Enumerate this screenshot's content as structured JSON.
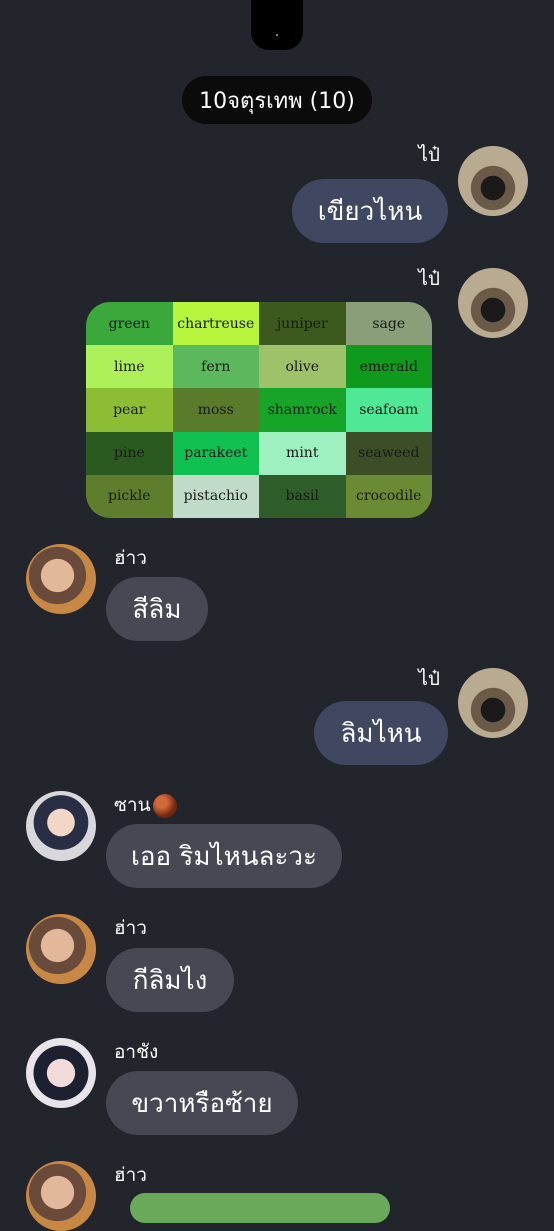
{
  "top_indicator": ".",
  "group_title": "10จตุรเทพ (10)",
  "messages": [
    {
      "sender": "ไป๋",
      "text": "เขียวไหน"
    },
    {
      "sender": "ไป๋"
    },
    {
      "sender": "ฮ่าว",
      "text": "สีลิม"
    },
    {
      "sender": "ไป๋",
      "text": "ลิมไหน"
    },
    {
      "sender": "ซาน",
      "text": "เออ ริมไหนละวะ"
    },
    {
      "sender": "ฮ่าว",
      "text": "กีลิมไง"
    },
    {
      "sender": "อาชัง",
      "text": "ขวาหรือซ้าย"
    },
    {
      "sender": "ฮ่าว"
    }
  ],
  "color_chart": [
    {
      "label": "green",
      "color": "#3aa83a"
    },
    {
      "label": "chartreuse",
      "color": "#b7f53c"
    },
    {
      "label": "juniper",
      "color": "#3c5a1e"
    },
    {
      "label": "sage",
      "color": "#8a9e7a"
    },
    {
      "label": "lime",
      "color": "#aef05a"
    },
    {
      "label": "fern",
      "color": "#5cb85c"
    },
    {
      "label": "olive",
      "color": "#9ec26a"
    },
    {
      "label": "emerald",
      "color": "#0f9a1e"
    },
    {
      "label": "pear",
      "color": "#8cbd34"
    },
    {
      "label": "moss",
      "color": "#5a7c2a"
    },
    {
      "label": "shamrock",
      "color": "#16a528"
    },
    {
      "label": "seafoam",
      "color": "#4ee896"
    },
    {
      "label": "pine",
      "color": "#2b5a20"
    },
    {
      "label": "parakeet",
      "color": "#10c050"
    },
    {
      "label": "mint",
      "color": "#9ef0c0"
    },
    {
      "label": "seaweed",
      "color": "#3c4e26"
    },
    {
      "label": "pickle",
      "color": "#5e7e2e"
    },
    {
      "label": "pistachio",
      "color": "#c0dcc8"
    },
    {
      "label": "basil",
      "color": "#305e2a"
    },
    {
      "label": "crocodile",
      "color": "#6a8a34"
    }
  ]
}
